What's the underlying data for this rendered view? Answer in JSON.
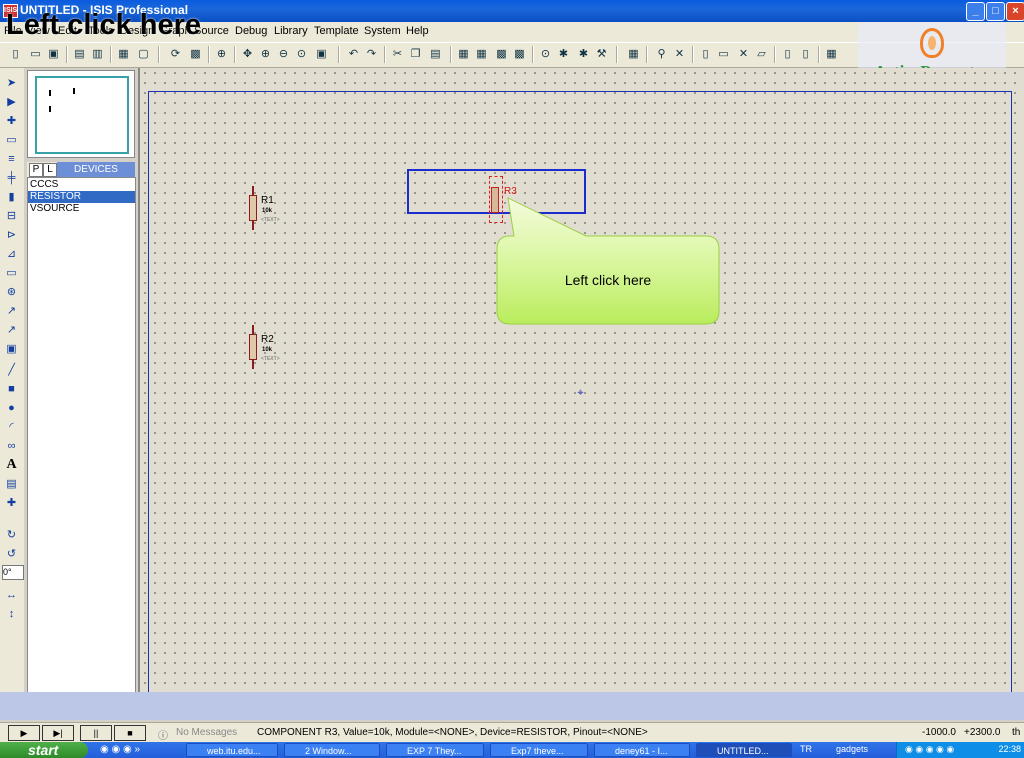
{
  "window": {
    "title": "UNTITLED - ISIS Professional",
    "icon_label": "ISIS"
  },
  "overlay": {
    "caption": "Left click here"
  },
  "menu": [
    "File",
    "View",
    "Edit",
    "Tools",
    "Design",
    "Graph",
    "Source",
    "Debug",
    "Library",
    "Template",
    "System",
    "Help"
  ],
  "watermark": {
    "text": "ActivePresenter"
  },
  "panel": {
    "tab_p": "P",
    "tab_l": "L",
    "title": "DEVICES",
    "devices": [
      {
        "name": "CCCS",
        "selected": false
      },
      {
        "name": "RESISTOR",
        "selected": true
      },
      {
        "name": "VSOURCE",
        "selected": false
      }
    ],
    "rotation": "0°"
  },
  "components": {
    "r1": {
      "ref": "R1",
      "value": "10k",
      "text": "<TEXT>"
    },
    "r2": {
      "ref": "R2",
      "value": "10k",
      "text": "<TEXT>"
    },
    "r3": {
      "ref": "R3"
    }
  },
  "callout": {
    "text": "Left click here"
  },
  "status": {
    "messages": "No Messages",
    "info": "COMPONENT R3, Value=10k, Module=<NONE>, Device=RESISTOR, Pinout=<NONE>",
    "coord_x": "-1000.0",
    "coord_y": "+2300.0",
    "unit": "th"
  },
  "taskbar": {
    "start": "start",
    "tasks": [
      "web.itu.edu...",
      "2 Window...",
      "EXP 7 They...",
      "Exp7 theve...",
      "deney61 - I...",
      "UNTITLED..."
    ],
    "tray_text": "TR",
    "tray_gadgets": "gadgets",
    "clock": "22:38"
  },
  "colors": {
    "titlebar": "#1c67d8",
    "selection": "#316ac5",
    "callout": "#c8f07a"
  }
}
